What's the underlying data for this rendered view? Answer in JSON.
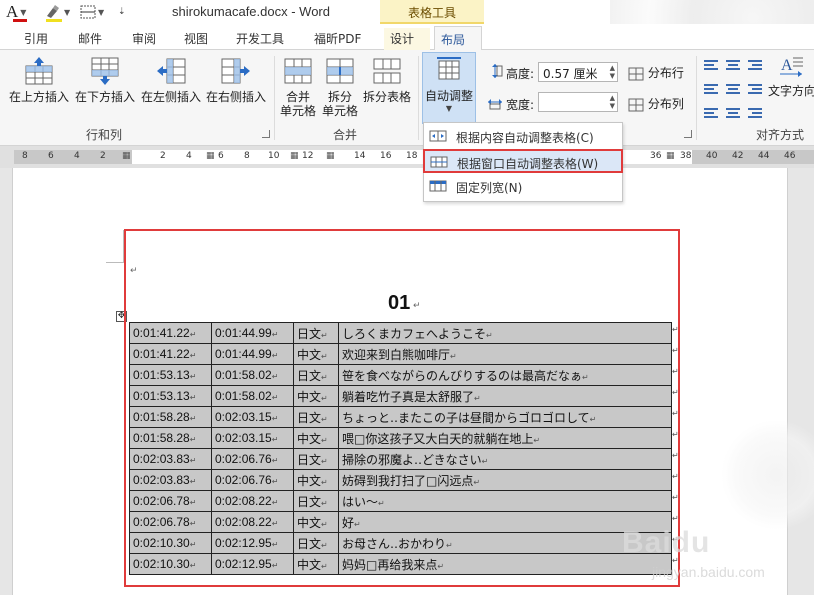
{
  "titlebar": {
    "font_color_letter": "A",
    "document_title": "shirokumacafe.docx - Word",
    "context_tab_group": "表格工具"
  },
  "tabs": [
    {
      "label": "引用"
    },
    {
      "label": "邮件"
    },
    {
      "label": "审阅"
    },
    {
      "label": "视图"
    },
    {
      "label": "开发工具"
    },
    {
      "label": "福昕PDF"
    },
    {
      "label": "设计"
    },
    {
      "label": "布局"
    }
  ],
  "ribbon": {
    "rows_cols": {
      "insert_above": "在上方插入",
      "insert_below": "在下方插入",
      "insert_left": "在左侧插入",
      "insert_right": "在右侧插入",
      "group_label": "行和列"
    },
    "merge": {
      "merge_cells_line1": "合并",
      "merge_cells_line2": "单元格",
      "split_cells_line1": "拆分",
      "split_cells_line2": "单元格",
      "split_table": "拆分表格",
      "group_label": "合并"
    },
    "cell_size": {
      "autofit": "自动调整",
      "height_label": "高度:",
      "height_value": "0.57 厘米",
      "width_label": "宽度:",
      "width_value": "",
      "distribute_rows": "分布行",
      "distribute_cols": "分布列"
    },
    "alignment": {
      "text_direction": "文字方向",
      "group_label": "对齐方式"
    }
  },
  "autofit_menu": {
    "items": [
      {
        "label": "根据内容自动调整表格(C)"
      },
      {
        "label": "根据窗口自动调整表格(W)"
      },
      {
        "label": "固定列宽(N)"
      }
    ],
    "highlighted_index": 1
  },
  "ruler": {
    "left_numbers": [
      "8",
      "6",
      "4",
      "2"
    ],
    "mid_numbers": [
      "2",
      "4",
      "6",
      "8",
      "10",
      "12",
      "14",
      "16",
      "18"
    ],
    "right_numbers": [
      "36",
      "38",
      "40",
      "42",
      "44",
      "46"
    ]
  },
  "document": {
    "heading": "01",
    "table": [
      [
        "0:01:41.22",
        "0:01:44.99",
        "日文",
        "しろくまカフェへようこそ"
      ],
      [
        "0:01:41.22",
        "0:01:44.99",
        "中文",
        "欢迎来到白熊咖啡厅"
      ],
      [
        "0:01:53.13",
        "0:01:58.02",
        "日文",
        "笹を食べながらのんびりするのは最高だなぁ"
      ],
      [
        "0:01:53.13",
        "0:01:58.02",
        "中文",
        "躺着吃竹子真是太舒服了"
      ],
      [
        "0:01:58.28",
        "0:02:03.15",
        "日文",
        "ちょっと‥またこの子は昼間からゴロゴロして"
      ],
      [
        "0:01:58.28",
        "0:02:03.15",
        "中文",
        "喂□你这孩子又大白天的就躺在地上"
      ],
      [
        "0:02:03.83",
        "0:02:06.76",
        "日文",
        "掃除の邪魔よ‥どきなさい"
      ],
      [
        "0:02:03.83",
        "0:02:06.76",
        "中文",
        "妨碍到我打扫了□闪远点"
      ],
      [
        "0:02:06.78",
        "0:02:08.22",
        "日文",
        "はい～"
      ],
      [
        "0:02:06.78",
        "0:02:08.22",
        "中文",
        "好"
      ],
      [
        "0:02:10.30",
        "0:02:12.95",
        "日文",
        "お母さん‥おかわり"
      ],
      [
        "0:02:10.30",
        "0:02:12.95",
        "中文",
        "妈妈□再给我来点"
      ]
    ]
  },
  "watermark": {
    "logo": "Baidu",
    "sub": "jingyan.baidu.com"
  },
  "colors": {
    "accent_blue": "#2b579a",
    "highlight_red": "#e03b3b",
    "context_yellow": "#fbf3c6",
    "table_cell_gray": "#c8c8c8"
  }
}
